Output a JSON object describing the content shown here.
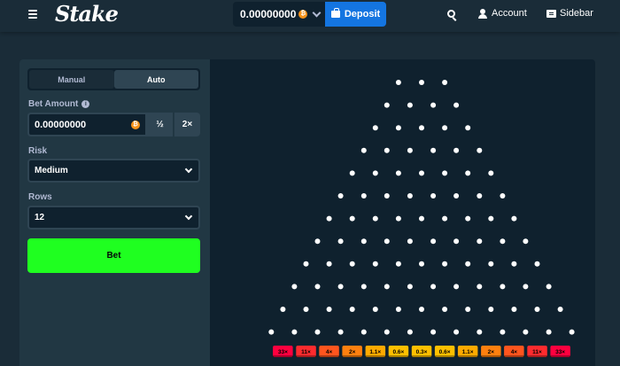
{
  "header": {
    "logo": "Stake",
    "balance": "0.00000000",
    "currency_icon": "btc-coin-icon",
    "deposit_label": "Deposit",
    "account_label": "Account",
    "sidebar_label": "Sidebar"
  },
  "controls": {
    "tabs": [
      {
        "label": "Manual",
        "active": false
      },
      {
        "label": "Auto",
        "active": true
      }
    ],
    "bet_amount_label": "Bet Amount",
    "bet_amount_value": "0.00000000",
    "half_label": "½",
    "double_label": "2×",
    "risk_label": "Risk",
    "risk_value": "Medium",
    "rows_label": "Rows",
    "rows_value": "12",
    "bet_button_label": "Bet"
  },
  "board": {
    "rows": 12,
    "multipliers": [
      "33×",
      "11×",
      "4×",
      "2×",
      "1.1×",
      "0.6×",
      "0.3×",
      "0.6×",
      "1.1×",
      "2×",
      "4×",
      "11×",
      "33×"
    ],
    "bucket_colors": [
      "#ff003f",
      "#ff2b2e",
      "#ff551e",
      "#ff800f",
      "#ffaa00",
      "#ffc000",
      "#ffc000",
      "#ffc000",
      "#ffaa00",
      "#ff800f",
      "#ff551e",
      "#ff2b2e",
      "#ff003f"
    ]
  },
  "colors": {
    "background": "#1a2c38",
    "panel": "#213743",
    "board": "#0f212e",
    "accent_blue": "#1475e1",
    "bet_green": "#1fff20"
  }
}
